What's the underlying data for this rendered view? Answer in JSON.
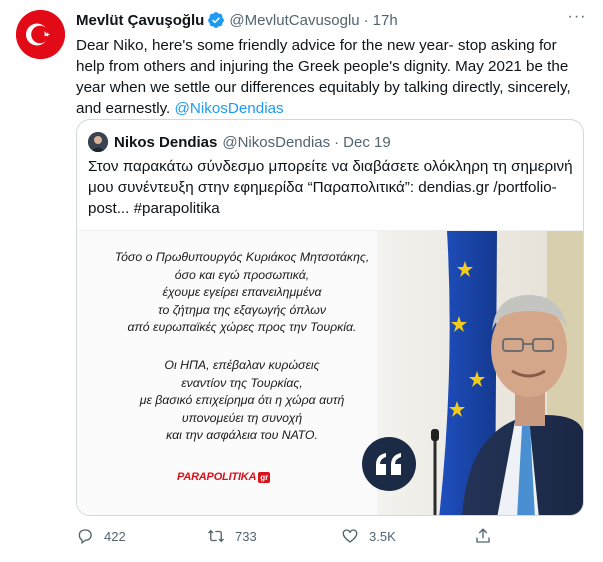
{
  "tweet": {
    "author_name": "Mevlüt Çavuşoğlu",
    "author_handle": "@MevlutCavusoglu",
    "separator": "·",
    "time": "17h",
    "more_label": "···",
    "text": "Dear Niko, here's some friendly advice for the new year- stop asking for help from others and injuring the Greek people's dignity. May 2021 be the year when we settle our differences equitably by talking directly, sincerely, and earnestly. ",
    "mention": "@NikosDendias"
  },
  "quoted": {
    "author_name": "Nikos Dendias",
    "author_handle": "@NikosDendias",
    "separator": "·",
    "date": "Dec 19",
    "text": "Στον παρακάτω σύνδεσμο μπορείτε να διαβάσετε ολόκληρη τη σημερινή μου συνέντευξη στην εφημερίδα “Παραπολιτικά”: dendias.gr /portfolio-post... #parapolitika",
    "media": {
      "paragraph1": [
        "Τόσο ο Πρωθυπουργός Κυριάκος Μητσοτάκης,",
        "όσο και εγώ προσωπικά,",
        "έχουμε εγείρει επανειλημμένα",
        "το ζήτημα της εξαγωγής όπλων",
        "από ευρωπαϊκές χώρες προς την Τουρκία."
      ],
      "paragraph2": [
        "Οι ΗΠΑ, επέβαλαν κυρώσεις",
        "εναντίον της Τουρκίας,",
        "με βασικό επιχείρημα ότι η χώρα αυτή",
        "υπονομεύει τη συνοχή",
        "και την ασφάλεια του ΝΑΤΟ."
      ],
      "logo_text": "PARAPOLITIKA",
      "logo_badge": "gr",
      "quote_mark": "66"
    }
  },
  "actions": {
    "replies": "422",
    "retweets": "733",
    "likes": "3.5K"
  },
  "colors": {
    "accent": "#1d9bf0",
    "secondary_text": "#536471",
    "turkish_red": "#e30a17",
    "parapolitika_red": "#d7121b",
    "eu_blue": "#1f4fbf"
  },
  "icons": [
    "verified-badge-icon",
    "more-icon",
    "reply-icon",
    "retweet-icon",
    "like-icon",
    "share-icon",
    "quote-mark-icon"
  ]
}
